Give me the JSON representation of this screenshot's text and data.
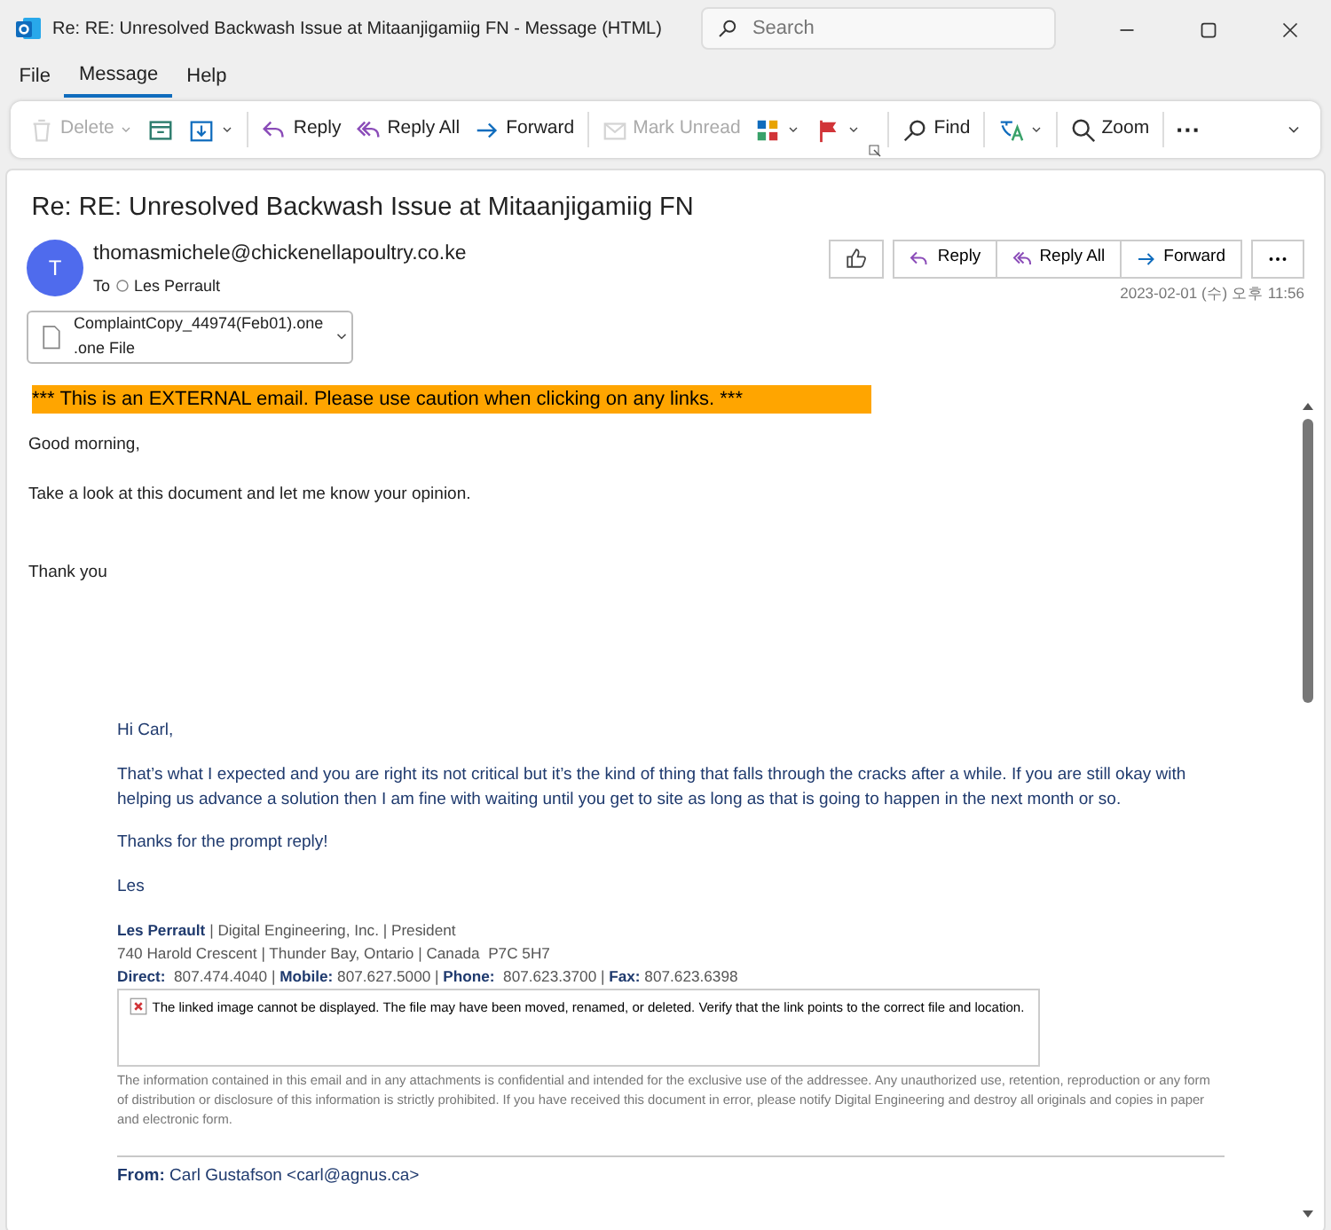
{
  "window": {
    "title": "Re: RE: Unresolved Backwash Issue at Mitaanjigamiig FN  -  Message (HTML)",
    "search": {
      "placeholder": "Search"
    }
  },
  "menu_tabs": [
    {
      "label": "File",
      "selected": false
    },
    {
      "label": "Message",
      "selected": true
    },
    {
      "label": "Help",
      "selected": false
    }
  ],
  "ribbon": [
    {
      "kind": "delete",
      "label": "Delete",
      "disabled": true,
      "dropdown": true
    },
    {
      "kind": "archive",
      "disabled": false,
      "dropdown": false
    },
    {
      "kind": "move",
      "disabled": false,
      "dropdown": true
    },
    {
      "kind": "reply",
      "label": "Reply",
      "disabled": false,
      "dropdown": false
    },
    {
      "kind": "replyall",
      "label": "Reply All",
      "disabled": false,
      "dropdown": false
    },
    {
      "kind": "forward",
      "label": "Forward",
      "disabled": false,
      "dropdown": false
    },
    {
      "kind": "unread",
      "label": "Mark Unread",
      "disabled": true,
      "dropdown": false
    },
    {
      "kind": "categorize",
      "disabled": false,
      "dropdown": true
    },
    {
      "kind": "flag",
      "disabled": false,
      "dropdown": true
    },
    {
      "kind": "find",
      "label": "Find",
      "disabled": false,
      "dropdown": false
    },
    {
      "kind": "translate",
      "disabled": false,
      "dropdown": true
    },
    {
      "kind": "zoom",
      "label": "Zoom",
      "disabled": false,
      "dropdown": false
    },
    {
      "kind": "more",
      "label": "···",
      "disabled": false,
      "dropdown": false
    }
  ],
  "message": {
    "subject": "Re: RE: Unresolved Backwash Issue at Mitaanjigamiig FN",
    "avatar": "T",
    "sender": "thomasmichele@chickenellapoultry.co.ke",
    "to_label": "To",
    "recipient": "Les Perrault",
    "date": "2023-02-01 (수) 오후 11:56",
    "actions": [
      {
        "kind": "reply",
        "label": "Reply"
      },
      {
        "kind": "replyall",
        "label": "Reply All"
      },
      {
        "kind": "forward",
        "label": "Forward"
      }
    ],
    "attachment": {
      "name": "ComplaintCopy_44974(Feb01).one",
      "type": ".one File"
    }
  },
  "body": {
    "banner": "*** This is an EXTERNAL email. Please use caution when clicking on any links. ***",
    "paragraphs": [
      "Good morning,",
      "Take a look at this document and let me know your opinion.",
      "Thank you"
    ],
    "quoted": [
      "Hi Carl,",
      "That’s what I expected and you are right its not critical but it’s the kind of thing that falls through the cracks after a while.  If you are still okay with helping us advance a solution then I am fine with waiting until you get to site as long as that is going to happen in the next month or so.",
      "Thanks for the prompt reply!",
      "Les"
    ],
    "signature": [
      [
        {
          "text": "Les Perrault",
          "kind": "name"
        },
        {
          "text": " | Digital Engineering, Inc. | President",
          "kind": "plain"
        }
      ],
      [
        {
          "text": "740 Harold Crescent | Thunder Bay, Ontario | Canada  P7C 5H7",
          "kind": "plain"
        }
      ],
      [
        {
          "text": "Direct:",
          "kind": "label"
        },
        {
          "text": "  807.474.4040 | ",
          "kind": "plain"
        },
        {
          "text": "Mobile:",
          "kind": "label"
        },
        {
          "text": " 807.627.5000 | ",
          "kind": "plain"
        },
        {
          "text": "Phone:",
          "kind": "label"
        },
        {
          "text": "  807.623.3700 | ",
          "kind": "plain"
        },
        {
          "text": "Fax:",
          "kind": "label"
        },
        {
          "text": " 807.623.6398",
          "kind": "plain"
        }
      ]
    ],
    "broken_image": "The linked image cannot be displayed.  The file may have been moved, renamed, or deleted. Verify that the link points to the correct file and location.",
    "disclaimer": "The information contained in this email and in any attachments is confidential and intended for the exclusive use of the addressee. Any unauthorized use, retention, reproduction or any form of distribution or disclosure of this information is strictly prohibited. If you have received this document in error, please notify Digital Engineering and destroy all originals and copies in paper and electronic form.",
    "from_line": "**From:** Carl Gustafson <carl@agnus.ca>"
  }
}
